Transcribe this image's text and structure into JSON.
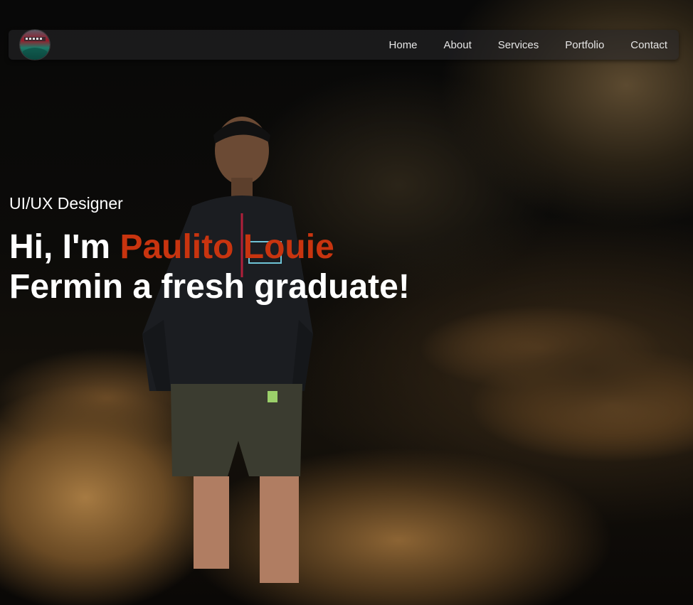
{
  "nav": {
    "logo_icon": "avatar-logo-icon",
    "items": [
      {
        "label": "Home"
      },
      {
        "label": "About"
      },
      {
        "label": "Services"
      },
      {
        "label": "Portfolio"
      },
      {
        "label": "Contact"
      }
    ]
  },
  "hero": {
    "subtitle": "UI/UX Designer",
    "greeting": "Hi, I'm ",
    "name": "Paulito Louie",
    "rest_line1_tail": "",
    "line2": "Fermin a fresh graduate!"
  },
  "colors": {
    "accent": "#c8340f",
    "text": "#ffffff",
    "nav_text": "#e6e6e6"
  }
}
